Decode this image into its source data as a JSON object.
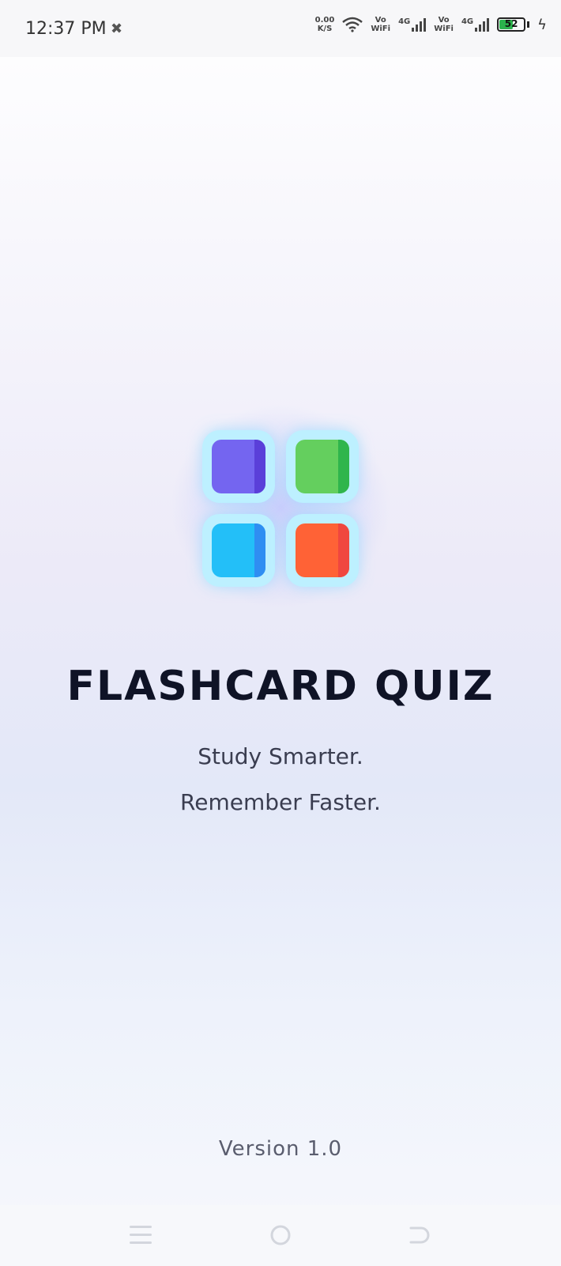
{
  "status_bar": {
    "time": "12:37 PM",
    "net_speed_value": "0.00",
    "net_speed_unit": "K/S",
    "vo_label_1": "Vo",
    "wifi_label_1": "WiFi",
    "net_type_1": "4G",
    "vo_label_2": "Vo",
    "wifi_label_2": "WiFi",
    "net_type_2": "4G",
    "battery_level": "52",
    "battery_fill_percent": 52
  },
  "logo": {
    "tiles": [
      {
        "color": "#7465f0",
        "stripe": "#5a3fd9"
      },
      {
        "color": "#64cf5e",
        "stripe": "#2fb54c"
      },
      {
        "color": "#23bff8",
        "stripe": "#2f8ef2"
      },
      {
        "color": "#ff6236",
        "stripe": "#f0473f"
      }
    ]
  },
  "title": "FLASHCARD QUIZ",
  "tagline_line1": "Study Smarter.",
  "tagline_line2": "Remember Faster.",
  "version": "Version 1.0"
}
